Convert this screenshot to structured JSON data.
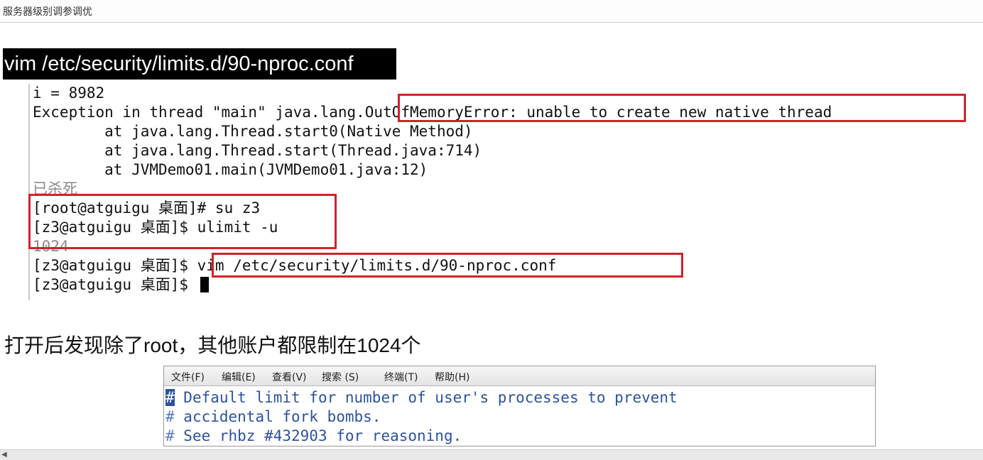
{
  "window": {
    "title": "服务器级别调参调优"
  },
  "banner": {
    "command": "vim /etc/security/limits.d/90-nproc.conf"
  },
  "terminal": {
    "lines": [
      "i = 8982",
      "Exception in thread \"main\" java.lang.OutOfMemoryError: unable to create new native thread",
      "        at java.lang.Thread.start0(Native Method)",
      "        at java.lang.Thread.start(Thread.java:714)",
      "        at JVMDemo01.main(JVMDemo01.java:12)",
      "已杀死",
      "[root@atguigu 桌面]# su z3",
      "[z3@atguigu 桌面]$ ulimit -u",
      "1024",
      "[z3@atguigu 桌面]$ vim /etc/security/limits.d/90-nproc.conf",
      "[z3@atguigu 桌面]$ "
    ]
  },
  "note": {
    "text": "打开后发现除了root，其他账户都限制在1024个"
  },
  "editor": {
    "menu": [
      "文件(F)",
      "编辑(E)",
      "查看(V)",
      "搜索 (S)",
      "终端(T)",
      "帮助(H)"
    ],
    "lines": [
      {
        "hash": "#",
        "text": " Default limit for number of user's processes to prevent"
      },
      {
        "hash": "#",
        "text": " accidental fork bombs."
      },
      {
        "hash": "#",
        "text": " See rhbz #432903 for reasoning."
      }
    ]
  },
  "colors": {
    "highlight": "#d0232a",
    "editor_text": "#2c52a0",
    "banner_bg": "#000000"
  }
}
